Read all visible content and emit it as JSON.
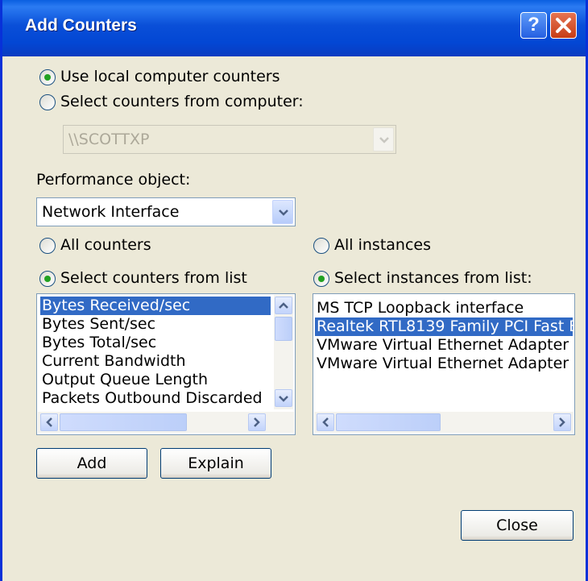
{
  "window": {
    "title": "Add Counters"
  },
  "title_buttons": {
    "help": "?"
  },
  "source": {
    "local_label": "Use local computer counters",
    "remote_label": "Select counters from computer:",
    "computer_value": "\\\\SCOTTXP"
  },
  "perf_object": {
    "label": "Performance object:",
    "value": "Network Interface"
  },
  "counters": {
    "all_label": "All counters",
    "list_label": "Select counters from list",
    "items": [
      "Bytes Received/sec",
      "Bytes Sent/sec",
      "Bytes Total/sec",
      "Current Bandwidth",
      "Output Queue Length",
      "Packets Outbound Discarded"
    ],
    "selected_index": 0
  },
  "instances": {
    "all_label": "All instances",
    "list_label": "Select instances from list:",
    "items": [
      "MS TCP Loopback interface",
      "Realtek RTL8139 Family PCI Fast E",
      "VMware Virtual Ethernet Adapter for",
      "VMware Virtual Ethernet Adapter for"
    ],
    "selected_index": 1
  },
  "buttons": {
    "add": "Add",
    "explain": "Explain",
    "close": "Close"
  },
  "colors": {
    "titlebar": "#0a4fd8",
    "selection": "#316ac5",
    "dialog": "#ece9d8",
    "radio_dot": "#21a121"
  }
}
